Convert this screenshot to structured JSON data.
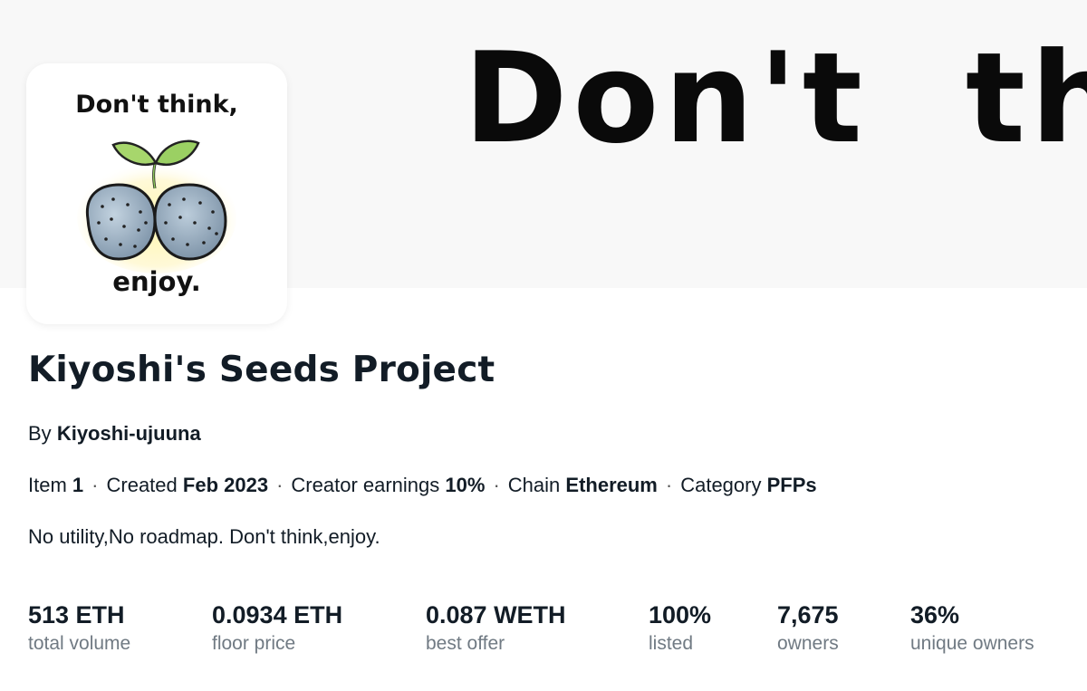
{
  "banner": {
    "text": "Don't  think"
  },
  "avatar": {
    "line1": "Don't think,",
    "line2": "enjoy."
  },
  "collection": {
    "title": "Kiyoshi's Seeds Project",
    "by_label": "By",
    "creator": "Kiyoshi-ujuuna",
    "description": "No utility,No roadmap. Don't think,enjoy."
  },
  "meta": {
    "separator": "·",
    "items_label": "Item",
    "items_value": "1",
    "created_label": "Created",
    "created_value": "Feb 2023",
    "earnings_label": "Creator earnings",
    "earnings_value": "10%",
    "chain_label": "Chain",
    "chain_value": "Ethereum",
    "category_label": "Category",
    "category_value": "PFPs"
  },
  "stats": [
    {
      "value": "513 ETH",
      "label": "total volume"
    },
    {
      "value": "0.0934 ETH",
      "label": "floor price"
    },
    {
      "value": "0.087 WETH",
      "label": "best offer"
    },
    {
      "value": "100%",
      "label": "listed"
    },
    {
      "value": "7,675",
      "label": "owners"
    },
    {
      "value": "36%",
      "label": "unique owners"
    }
  ]
}
